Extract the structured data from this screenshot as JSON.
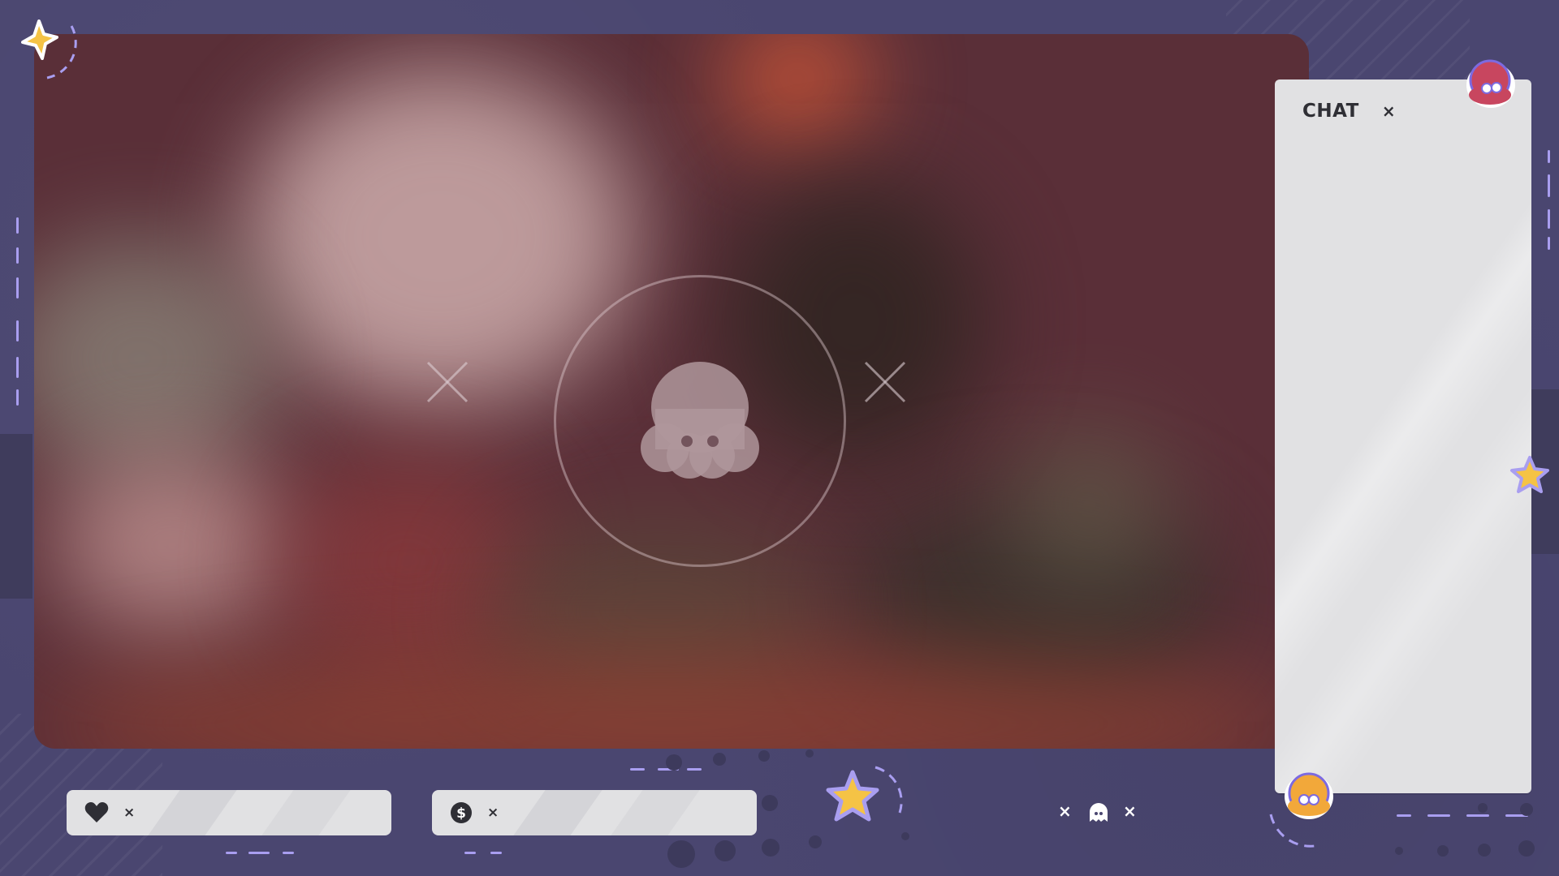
{
  "chat": {
    "title": "CHAT",
    "close_label": "×"
  },
  "stats": {
    "likes": {
      "icon": "heart-icon",
      "separator": "×",
      "value": ""
    },
    "donations": {
      "icon": "dollar-icon",
      "separator": "×",
      "value": ""
    }
  },
  "center_icon": "octopus-icon",
  "bottom_right": {
    "left_x": "×",
    "right_x": "×",
    "icon": "ghost-icon"
  },
  "colors": {
    "background": "#4a4670",
    "panel": "#e1e1e3",
    "accent_dash": "#a99ef0",
    "star_gold": "#f5c345",
    "mascot_pink": "#c8465f",
    "mascot_orange": "#f2a83a"
  }
}
